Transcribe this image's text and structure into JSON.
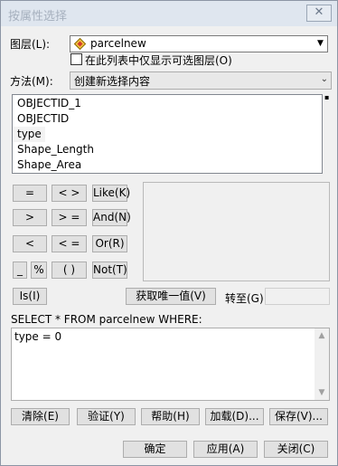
{
  "window": {
    "title": "按属性选择",
    "close_glyph": "✕"
  },
  "layer": {
    "label": "图层(L):",
    "value": "parcelnew",
    "only_selectable_label": "在此列表中仅显示可选图层(O)"
  },
  "method": {
    "label": "方法(M):",
    "value": "创建新选择内容"
  },
  "fields": [
    "OBJECTID_1",
    "OBJECTID",
    "type",
    "Shape_Length",
    "Shape_Area"
  ],
  "operators": {
    "eq": "=",
    "ne": "< >",
    "like": "Like(K)",
    "gt": ">",
    "ge": "> =",
    "and": "And(N)",
    "lt": "<",
    "le": "< =",
    "or": "Or(R)",
    "underscore": "_",
    "percent": "%",
    "parens": "( )",
    "not": "Not(T)",
    "is": "Is(I)"
  },
  "unique_values_button": "获取唯一值(V)",
  "goto_label": "转至(G):",
  "sql_prefix": "SELECT * FROM parcelnew WHERE:",
  "expression": "type = 0",
  "bottom_buttons": {
    "clear": "清除(E)",
    "verify": "验证(Y)",
    "help": "帮助(H)",
    "load": "加载(D)...",
    "save": "保存(V)..."
  },
  "dialog_buttons": {
    "ok": "确定",
    "apply": "应用(A)",
    "close": "关闭(C)"
  }
}
